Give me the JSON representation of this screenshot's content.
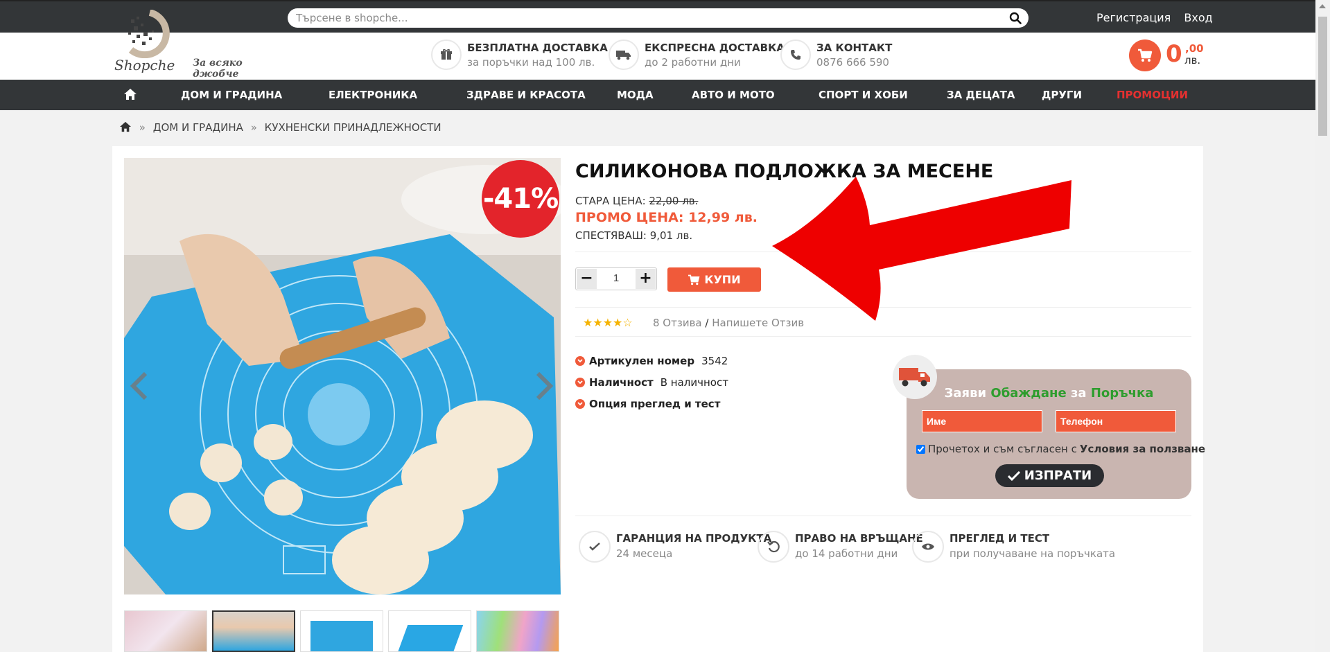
{
  "search": {
    "placeholder": "Търсене в shopche..."
  },
  "toplinks": {
    "register": "Регистрация",
    "login": "Вход"
  },
  "logo": {
    "name": "Shopche",
    "tagline": "За всяко джобче"
  },
  "features": [
    {
      "title": "БЕЗПЛАТНА ДОСТАВКА",
      "sub": "за поръчки над 100 лв.",
      "icon": "gift-icon"
    },
    {
      "title": "ЕКСПРЕСНА ДОСТАВКА",
      "sub": "до 2 работни дни",
      "icon": "truck-icon"
    },
    {
      "title": "ЗА КОНТАКТ",
      "sub": "0876 666 590",
      "icon": "phone-icon"
    }
  ],
  "cart": {
    "amount": "0",
    "decimals": ",00",
    "currency": "лв."
  },
  "nav": [
    "ДОМ И ГРАДИНА",
    "ЕЛЕКТРОНИКА",
    "ЗДРАВЕ И КРАСОТА",
    "МОДА",
    "АВТО И МОТО",
    "СПОРТ И ХОБИ",
    "ЗА ДЕЦАТА",
    "ДРУГИ",
    "ПРОМОЦИИ"
  ],
  "breadcrumb": {
    "sep": "»",
    "items": [
      "ДОМ И ГРАДИНА",
      "КУХНЕНСКИ ПРИНАДЛЕЖНОСТИ"
    ]
  },
  "product": {
    "discount_badge": "-41%",
    "title": "СИЛИКОНОВА ПОДЛОЖКА ЗА МЕСЕНЕ",
    "old_price_label": "СТАРА ЦЕНА:",
    "old_price": "22,00 лв.",
    "promo_price": "ПРОМО ЦЕНА: 12,99 лв.",
    "save_label": "СПЕСТЯВАШ:",
    "save_value": "9,01 лв.",
    "quantity": "1",
    "buy_label": "КУПИ",
    "rating": 4,
    "rating_max": 5,
    "reviews": "8 Отзива",
    "write_review": "Напишете Отзив",
    "attributes": [
      {
        "label": "Артикулен номер",
        "value": "3542"
      },
      {
        "label": "Наличност",
        "value": "В наличност"
      },
      {
        "label": "Опция преглед и тест",
        "value": ""
      }
    ]
  },
  "callback": {
    "title_1": "Заяви",
    "title_2": "Обаждане",
    "title_3": "за",
    "title_4": "Поръчка",
    "name_placeholder": "Име",
    "phone_placeholder": "Телефон",
    "agree_text": "Прочетох и съм съгласен с",
    "agree_link": "Условия за ползване",
    "send_label": "ИЗПРАТИ"
  },
  "guarantees": [
    {
      "title": "ГАРАНЦИЯ НА ПРОДУКТА",
      "sub": "24 месеца",
      "icon": "check-icon"
    },
    {
      "title": "ПРАВО НА ВРЪЩАНЕ",
      "sub": "до 14 работни дни",
      "icon": "return-icon"
    },
    {
      "title": "ПРЕГЛЕД И ТЕСТ",
      "sub": "при получаване на поръчката",
      "icon": "eye-icon"
    }
  ],
  "colors": {
    "accent": "#f05a3a",
    "dark": "#333638",
    "promo_nav": "#e53030",
    "badge": "#e3242b",
    "callbox": "#c9b5b0"
  }
}
